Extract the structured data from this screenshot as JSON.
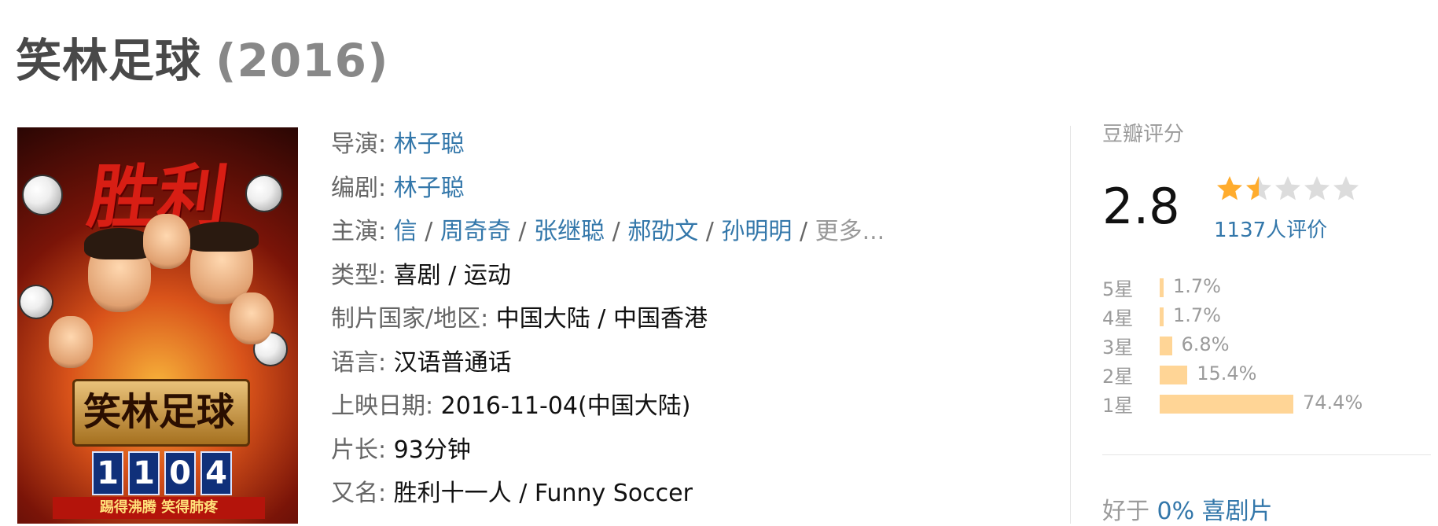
{
  "movie": {
    "title": "笑林足球",
    "year": "(2016)"
  },
  "poster": {
    "headline": "胜利",
    "title_text": "笑林足球",
    "digits": [
      "1",
      "1",
      "0",
      "4"
    ],
    "banner": "踢得沸腾 笑得肺疼"
  },
  "info": {
    "director": {
      "label": "导演",
      "value": "林子聪"
    },
    "writer": {
      "label": "编剧",
      "value": "林子聪"
    },
    "cast": {
      "label": "主演",
      "names": [
        "信",
        "周奇奇",
        "张继聪",
        "郝劭文",
        "孙明明"
      ],
      "more": "更多..."
    },
    "genre": {
      "label": "类型",
      "value": "喜剧 / 运动"
    },
    "region": {
      "label": "制片国家/地区",
      "value": "中国大陆 / 中国香港"
    },
    "language": {
      "label": "语言",
      "value": "汉语普通话"
    },
    "release": {
      "label": "上映日期",
      "value": "2016-11-04(中国大陆)"
    },
    "runtime": {
      "label": "片长",
      "value": "93分钟"
    },
    "aka": {
      "label": "又名",
      "value": "胜利十一人 / Funny Soccer"
    }
  },
  "rating": {
    "label": "豆瓣评分",
    "score": "2.8",
    "stars_value": 1.5,
    "stars_max": 5,
    "votes": "1137人评价",
    "distribution": [
      {
        "label": "5星",
        "pct": "1.7%",
        "value": 1.7
      },
      {
        "label": "4星",
        "pct": "1.7%",
        "value": 1.7
      },
      {
        "label": "3星",
        "pct": "6.8%",
        "value": 6.8
      },
      {
        "label": "2星",
        "pct": "15.4%",
        "value": 15.4
      },
      {
        "label": "1星",
        "pct": "74.4%",
        "value": 74.4
      }
    ],
    "better_than": {
      "prefix": "好于",
      "link": "0% 喜剧片"
    }
  },
  "colors": {
    "link": "#3377aa",
    "label": "#666666",
    "star": "#ffac2d",
    "star_empty": "#dcdcdc",
    "bar": "#ffd596"
  }
}
